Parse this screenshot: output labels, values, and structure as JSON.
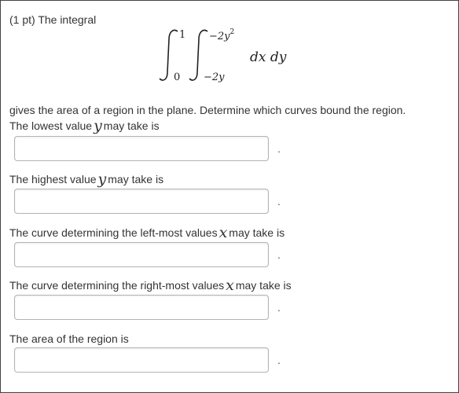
{
  "problem": {
    "intro": "(1 pt) The integral",
    "integral": {
      "outer_lower": "0",
      "outer_upper": "1",
      "inner_lower": "−2y",
      "inner_upper_base": "−2y",
      "inner_upper_exp": "2",
      "integrand": "dx dy"
    },
    "description": "gives the area of a region in the plane. Determine which curves bound the region."
  },
  "questions": [
    {
      "text_before": "The lowest value",
      "variable": "y",
      "text_after": "may take is",
      "value": ""
    },
    {
      "text_before": "The highest value",
      "variable": "y",
      "text_after": "may take is",
      "value": ""
    },
    {
      "text_before": "The curve determining the left-most values",
      "variable": "x",
      "text_after": "may take is",
      "value": ""
    },
    {
      "text_before": "The curve determining the right-most values",
      "variable": "x",
      "text_after": "may take is",
      "value": ""
    },
    {
      "text_before": "The area of the region is",
      "variable": "",
      "text_after": "",
      "value": ""
    }
  ],
  "answer_terminator": "."
}
